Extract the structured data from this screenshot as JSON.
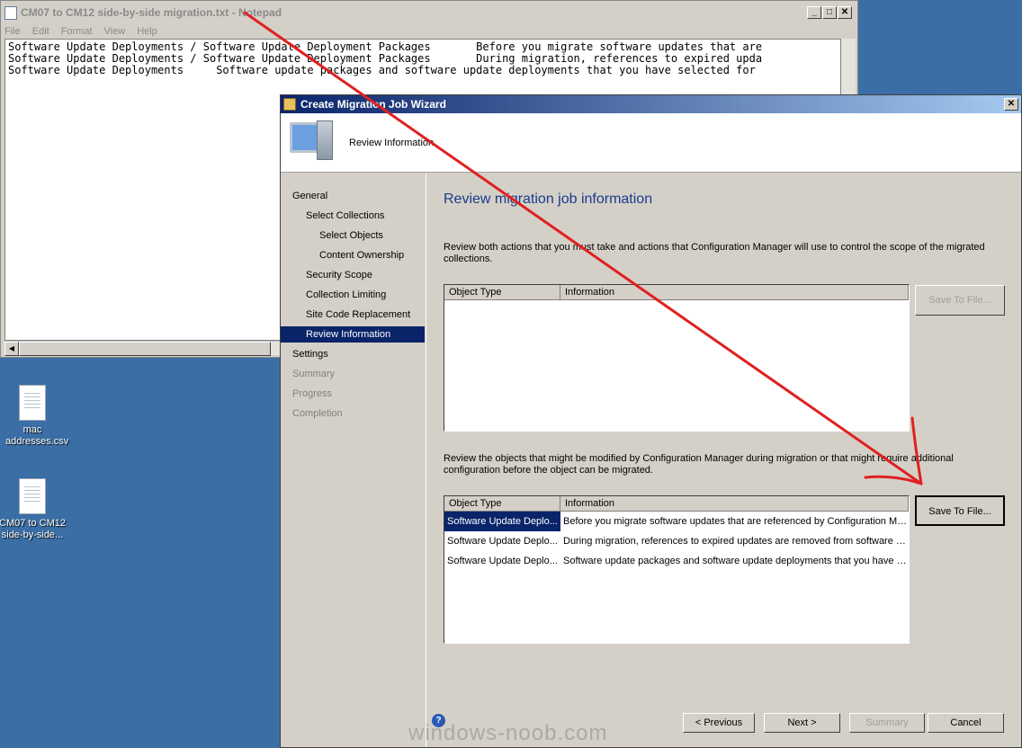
{
  "desktop": {
    "icons": [
      {
        "label": "mac addresses.csv"
      },
      {
        "label": "CM07 to CM12 side-by-side..."
      }
    ]
  },
  "notepad": {
    "title": "CM07 to CM12 side-by-side migration.txt - Notepad",
    "menu": [
      "File",
      "Edit",
      "Format",
      "View",
      "Help"
    ],
    "lines": [
      "Software Update Deployments / Software Update Deployment Packages       Before you migrate software updates that are",
      "Software Update Deployments / Software Update Deployment Packages       During migration, references to expired upda",
      "Software Update Deployments     Software update packages and software update deployments that you have selected for"
    ]
  },
  "wizard": {
    "title": "Create Migration Job Wizard",
    "header": "Review Information",
    "nav": [
      {
        "label": "General"
      },
      {
        "label": "Select Collections"
      },
      {
        "label": "Select Objects"
      },
      {
        "label": "Content Ownership"
      },
      {
        "label": "Security Scope"
      },
      {
        "label": "Collection Limiting"
      },
      {
        "label": "Site Code Replacement"
      },
      {
        "label": "Review Information"
      },
      {
        "label": "Settings"
      },
      {
        "label": "Summary"
      },
      {
        "label": "Progress"
      },
      {
        "label": "Completion"
      }
    ],
    "page_title": "Review migration job information",
    "desc1": "Review both actions that you must take and actions that Configuration Manager will use to control the scope of the migrated collections.",
    "list1": {
      "col1": "Object Type",
      "col2": "Information"
    },
    "save1": "Save To File...",
    "desc2": "Review the objects that might be modified by Configuration Manager during migration or that might require additional configuration before the object can be migrated.",
    "list2": {
      "col1": "Object Type",
      "col2": "Information",
      "rows": [
        {
          "type": "Software Update Deplo...",
          "info": "Before you migrate software updates that are referenced by Configuration Man..."
        },
        {
          "type": "Software Update Deplo...",
          "info": "During migration, references to expired updates are removed from software upd..."
        },
        {
          "type": "Software Update Deplo...",
          "info": "Software update packages and software update deployments that you have s..."
        }
      ]
    },
    "save2": "Save To File...",
    "buttons": {
      "previous": "< Previous",
      "next": "Next >",
      "summary": "Summary",
      "cancel": "Cancel"
    }
  },
  "watermark": "windows-noob.com",
  "colors": {
    "annotation_arrow": "#e02020",
    "selection": "#0a246a"
  }
}
